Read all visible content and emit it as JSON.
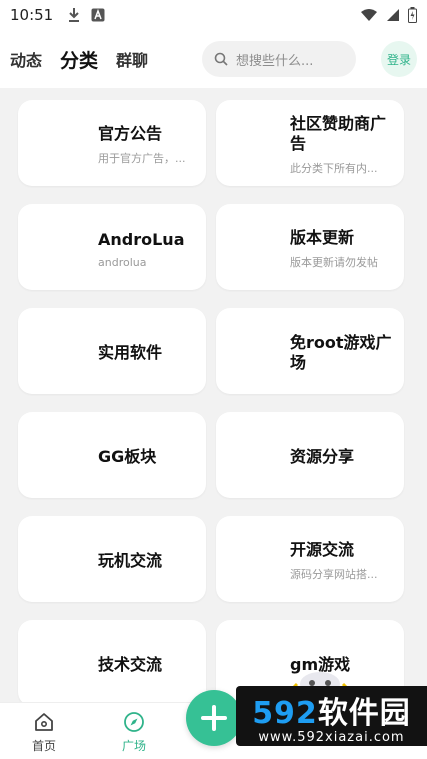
{
  "status_bar": {
    "time": "10:51",
    "icons": [
      "download-icon",
      "a-badge-icon",
      "wifi-icon",
      "signal-icon",
      "battery-icon"
    ]
  },
  "header": {
    "tabs": [
      {
        "label": "动态"
      },
      {
        "label": "分类"
      },
      {
        "label": "群聊"
      }
    ],
    "search_placeholder": "想搜些什么...",
    "login_label": "登录"
  },
  "categories": [
    {
      "title": "官方公告",
      "desc": "用于官方广告，..."
    },
    {
      "title": "社区赞助商广告",
      "desc": "此分类下所有内..."
    },
    {
      "title": "AndroLua",
      "desc": "androlua"
    },
    {
      "title": "版本更新",
      "desc": "版本更新请勿发帖"
    },
    {
      "title": "实用软件",
      "desc": ""
    },
    {
      "title": "免root游戏广场",
      "desc": ""
    },
    {
      "title": "GG板块",
      "desc": ""
    },
    {
      "title": "资源分享",
      "desc": ""
    },
    {
      "title": "玩机交流",
      "desc": ""
    },
    {
      "title": "开源交流",
      "desc": "源码分享网站搭..."
    },
    {
      "title": "技术交流",
      "desc": ""
    },
    {
      "title": "gm游戏",
      "desc": ""
    }
  ],
  "bottom_nav": {
    "items": [
      {
        "label": "首页",
        "icon": "home-icon"
      },
      {
        "label": "广场",
        "icon": "compass-icon"
      }
    ],
    "fab_icon": "plus-icon"
  },
  "watermark": {
    "main_prefix": "592",
    "main_suffix": "软件园",
    "sub": "www.592xiazai.com"
  },
  "colors": {
    "accent": "#36c195",
    "accent_light": "#9edfc6",
    "watermark_blue": "#1e9df2"
  }
}
